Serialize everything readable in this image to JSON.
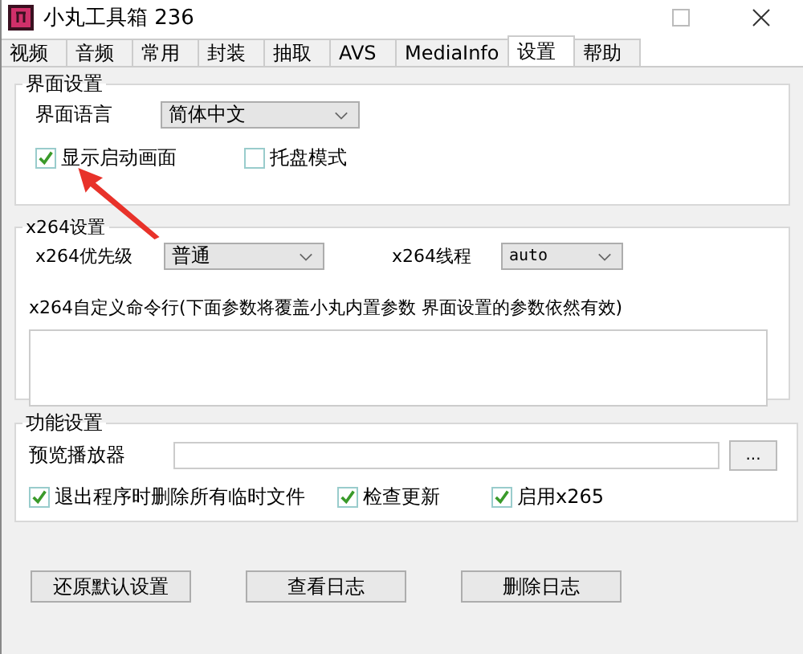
{
  "window": {
    "title": "小丸工具箱 236"
  },
  "tabs": [
    {
      "label": "视频",
      "selected": false
    },
    {
      "label": "音频",
      "selected": false
    },
    {
      "label": "常用",
      "selected": false
    },
    {
      "label": "封装",
      "selected": false
    },
    {
      "label": "抽取",
      "selected": false
    },
    {
      "label": "AVS",
      "selected": false
    },
    {
      "label": "MediaInfo",
      "selected": false
    },
    {
      "label": "设置",
      "selected": true
    },
    {
      "label": "帮助",
      "selected": false
    }
  ],
  "interface_group": {
    "title": "界面设置",
    "language_label": "界面语言",
    "language_value": "简体中文",
    "checkboxes": [
      {
        "label": "显示启动画面",
        "checked": true
      },
      {
        "label": "托盘模式",
        "checked": false
      }
    ]
  },
  "x264_group": {
    "title": "x264设置",
    "priority_label": "x264优先级",
    "priority_value": "普通",
    "threads_label": "x264线程",
    "threads_value": "auto",
    "custom_label": "x264自定义命令行(下面参数将覆盖小丸内置参数 界面设置的参数依然有效)"
  },
  "function_group": {
    "title": "功能设置",
    "player_label": "预览播放器",
    "browse_button": "...",
    "checkboxes": [
      {
        "label": "退出程序时删除所有临时文件",
        "checked": true
      },
      {
        "label": "检查更新",
        "checked": true
      },
      {
        "label": "启用x265",
        "checked": true
      }
    ]
  },
  "buttons": [
    "还原默认设置",
    "查看日志",
    "删除日志"
  ]
}
